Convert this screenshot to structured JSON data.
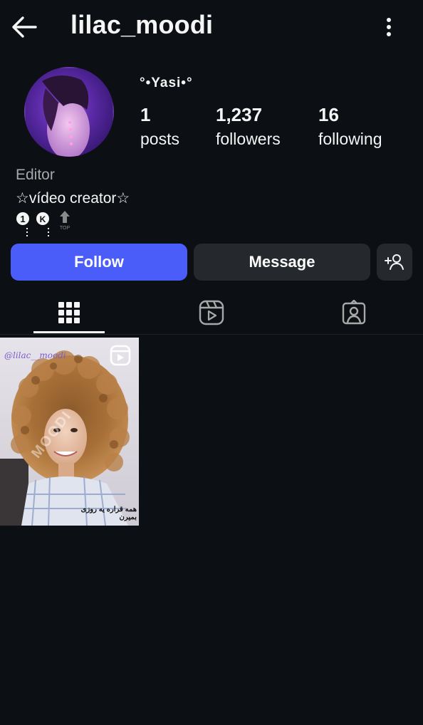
{
  "header": {
    "username": "lilac_moodi"
  },
  "profile": {
    "display_name": "°•Yasi•°",
    "stats": [
      {
        "value": "1",
        "label": "posts"
      },
      {
        "value": "1,237",
        "label": "followers"
      },
      {
        "value": "16",
        "label": "following"
      }
    ],
    "category": "Editor",
    "bio": "☆vídeo creator☆",
    "bio_emojis": [
      "keycap-one-icon",
      "circled-k-icon",
      "top-arrow-icon"
    ],
    "top_label": "TOP"
  },
  "actions": {
    "follow_label": "Follow",
    "message_label": "Message"
  },
  "tabs": [
    {
      "name": "posts-grid",
      "active": true
    },
    {
      "name": "reels",
      "active": false
    },
    {
      "name": "tagged",
      "active": false
    }
  ],
  "posts": [
    {
      "type": "reel",
      "watermark": "@lilac__moodi",
      "overlay_text": "MOODI",
      "caption": "همه قراره یه روزی بمیرن"
    }
  ],
  "colors": {
    "background": "#0c1014",
    "follow_button": "#4a5df9",
    "secondary_button": "#25292e",
    "muted_text": "#a8a8a8"
  }
}
